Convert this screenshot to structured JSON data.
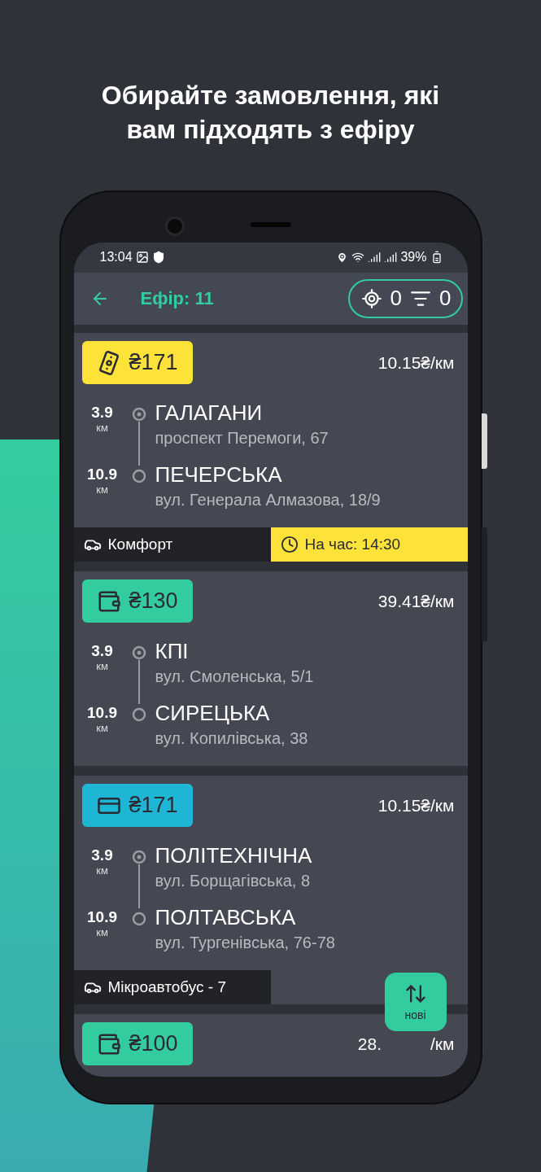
{
  "headline": "Обирайте замовлення, які вам підходять з ефіру",
  "status_bar": {
    "time": "13:04",
    "battery": "39%"
  },
  "app_bar": {
    "title": "Ефір: 11",
    "radius_count": "0",
    "filter_count": "0"
  },
  "orders": [
    {
      "kind": "cash",
      "price": "₴171",
      "rate": "10.15₴/км",
      "stops": [
        {
          "distance": "3.9",
          "unit": "км",
          "name": "ГАЛАГАНИ",
          "address": "проспект Перемоги, 67"
        },
        {
          "distance": "10.9",
          "unit": "км",
          "name": "ПЕЧЕРСЬКА",
          "address": "вул. Генерала Алмазова, 18/9"
        }
      ],
      "tags": [
        {
          "kind": "car_class",
          "text": "Комфорт"
        },
        {
          "kind": "scheduled",
          "text": "На час: 14:30"
        }
      ]
    },
    {
      "kind": "wallet",
      "price": "₴130",
      "rate": "39.41₴/км",
      "stops": [
        {
          "distance": "3.9",
          "unit": "км",
          "name": "КПІ",
          "address": "вул. Смоленська, 5/1"
        },
        {
          "distance": "10.9",
          "unit": "км",
          "name": "СИРЕЦЬКА",
          "address": "вул. Копилівська, 38"
        }
      ]
    },
    {
      "kind": "card",
      "price": "₴171",
      "rate": "10.15₴/км",
      "stops": [
        {
          "distance": "3.9",
          "unit": "км",
          "name": "ПОЛІТЕХНІЧНА",
          "address": "вул. Борщагівська, 8"
        },
        {
          "distance": "10.9",
          "unit": "км",
          "name": "ПОЛТАВСЬКА",
          "address": "вул. Тургенівська, 76-78"
        }
      ],
      "tags": [
        {
          "kind": "car_class",
          "text": "Мікроавтобус - 7"
        }
      ]
    },
    {
      "kind": "wallet",
      "price": "₴100",
      "rate_parts": [
        "28.",
        "/км"
      ]
    }
  ],
  "fab": {
    "label": "нові"
  }
}
